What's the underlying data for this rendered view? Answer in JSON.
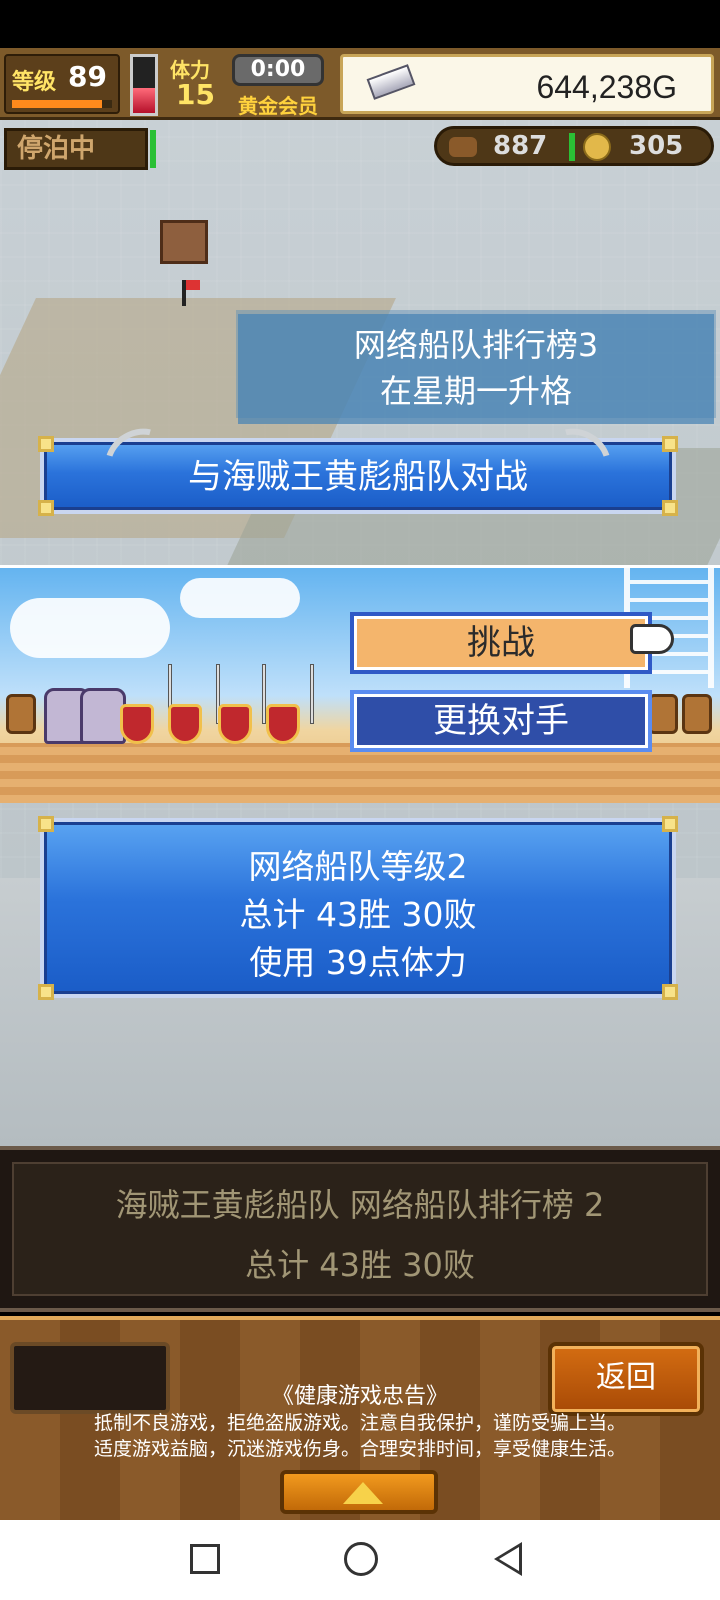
{
  "hud": {
    "level_label": "等级",
    "level_value": "89",
    "level_progress": 0.9,
    "stamina_label": "体力",
    "stamina_value": "15",
    "stamina_fill": 0.45,
    "time": "0:00",
    "membership": "黄金会员",
    "money": "644,238G",
    "status_docked": "停泊中",
    "resource_a": "887",
    "resource_b": "305"
  },
  "rank_panel": {
    "line1": "网络船队排行榜3",
    "line2": "在星期一升格"
  },
  "battle_banner": "与海贼王黄彪船队对战",
  "actions": {
    "challenge": "挑战",
    "change_opponent": "更换对手"
  },
  "info": {
    "line1": "网络船队等级2",
    "line2": "总计 43胜 30败",
    "line3": "使用 39点体力"
  },
  "dark_panel": {
    "line1": "海贼王黄彪船队  网络船队排行榜  2",
    "line2": "总计 43胜 30败"
  },
  "footer": {
    "back": "返回",
    "notice_title": "《健康游戏忠告》",
    "notice_line1": "抵制不良游戏，拒绝盗版游戏。注意自我保护，谨防受骗上当。",
    "notice_line2": "适度游戏益脑，沉迷游戏伤身。合理安排时间，享受健康生活。"
  },
  "colors": {
    "banner_blue": "#2b73db",
    "challenge_button": "#f4b56c",
    "change_button": "#2f4ea8",
    "money_panel": "#fbf7e8"
  }
}
